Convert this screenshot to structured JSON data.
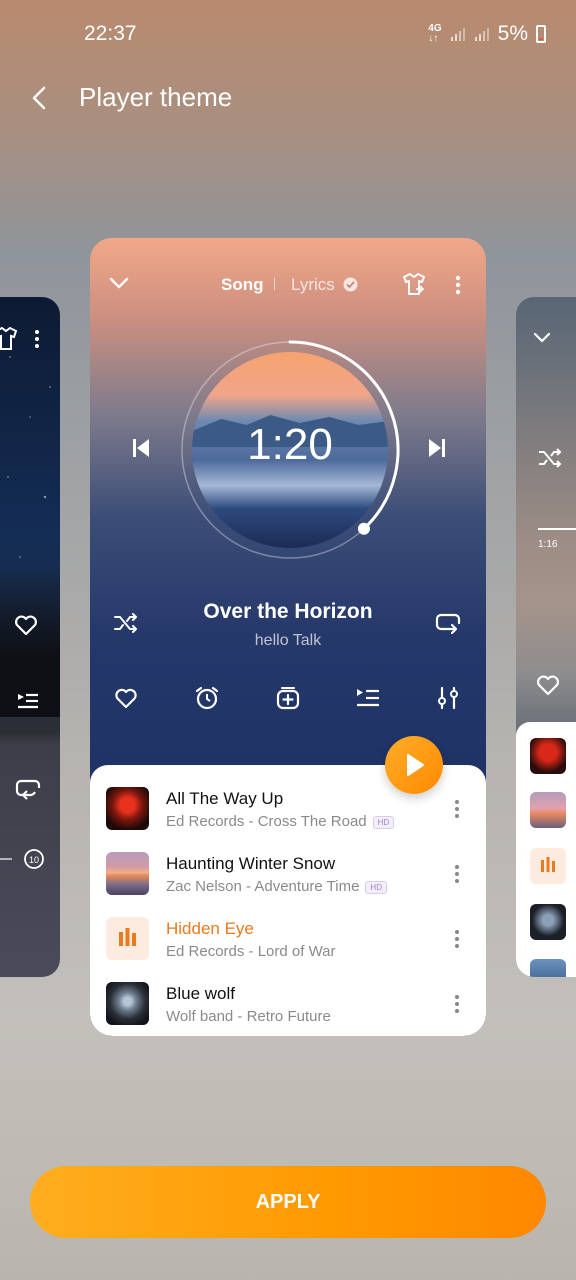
{
  "status_bar": {
    "time": "22:37",
    "network": "4G",
    "battery": "5%"
  },
  "header": {
    "title": "Player theme"
  },
  "player": {
    "tabs": {
      "song": "Song",
      "lyrics": "Lyrics"
    },
    "elapsed": "1:20",
    "song_title": "Over the Horizon",
    "artist": "hello Talk",
    "progress_fraction": 0.38
  },
  "side_right": {
    "time": "1:16"
  },
  "side_left": {
    "replay_badge": "10"
  },
  "tracks": [
    {
      "title": "All The Way Up",
      "subtitle": "Ed Records - Cross The Road",
      "badge": "HD",
      "active": false
    },
    {
      "title": "Haunting Winter Snow",
      "subtitle": "Zac Nelson - Adventure Time",
      "badge": "HD",
      "active": false
    },
    {
      "title": "Hidden Eye",
      "subtitle": "Ed Records - Lord of War",
      "badge": "",
      "active": true
    },
    {
      "title": "Blue wolf",
      "subtitle": "Wolf band - Retro Future",
      "badge": "",
      "active": false
    }
  ],
  "apply_label": "APPLY",
  "colors": {
    "accent": "#ff9a00",
    "active_track": "#ea7a1c"
  }
}
